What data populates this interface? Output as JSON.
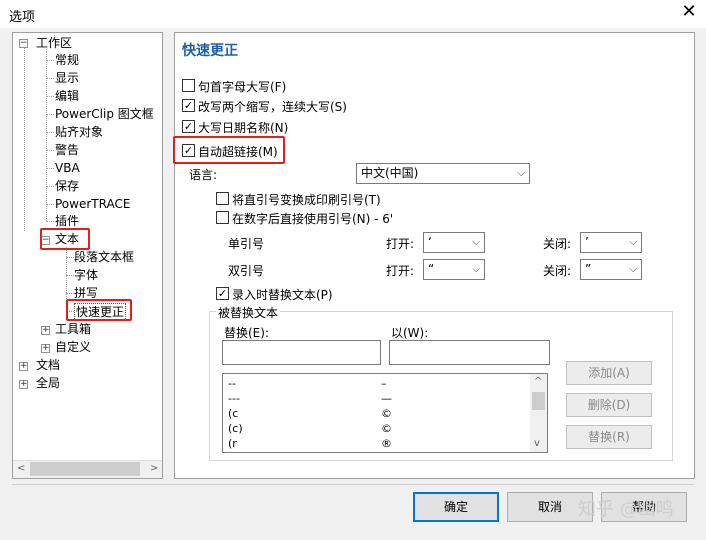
{
  "window": {
    "title": "选项",
    "close_label": "✕"
  },
  "tree": {
    "workspace": "工作区",
    "workspace_children": [
      "常规",
      "显示",
      "编辑",
      "PowerClip 图文框",
      "贴齐对象",
      "警告",
      "VBA",
      "保存",
      "PowerTRACE",
      "插件"
    ],
    "text": "文本",
    "text_children": [
      "段落文本框",
      "字体",
      "拼写",
      "快速更正"
    ],
    "toolbox": "工具箱",
    "customize": "自定义",
    "document": "文档",
    "global": "全局",
    "expanded_sign": "−",
    "collapsed_sign": "+",
    "scroll_left": "<",
    "scroll_right": ">"
  },
  "pane": {
    "heading": "快速更正",
    "opt_capitalize_first": "句首字母大写(F)",
    "opt_two_initial_caps": "改写两个缩写，连续大写(S)",
    "opt_capitalize_days": "大写日期名称(N)",
    "opt_hyperlink": "自动超链接(M)",
    "checks": {
      "capitalize_first": false,
      "two_initial_caps": true,
      "capitalize_days": true,
      "hyperlink": true,
      "straight_quotes": false,
      "primes": false,
      "replace_text": true
    },
    "check_mark": "✓",
    "language_label": "语言:",
    "language_value": "中文(中国)",
    "opt_straight_quotes": "将直引号变换成印刷引号(T)",
    "opt_primes": "在数字后直接使用引号(N) - 6'",
    "single_quote_label": "单引号",
    "double_quote_label": "双引号",
    "open_label": "打开:",
    "close_label": "关闭:",
    "single_open": "‘",
    "single_close": "’",
    "double_open": "“",
    "double_close": "”",
    "opt_replace_text": "录入时替换文本(P)",
    "replace_group": "被替换文本",
    "replace_label": "替换(E):",
    "with_label": "以(W):",
    "list_rows": [
      {
        "from": "--",
        "to": "–"
      },
      {
        "from": "---",
        "to": "—"
      },
      {
        "from": "(c",
        "to": "©"
      },
      {
        "from": "(c)",
        "to": "©"
      },
      {
        "from": "(r",
        "to": "®"
      }
    ],
    "add_button": "添加(A)",
    "delete_button": "删除(D)",
    "replace_button": "替换(R)",
    "scroll_up": "^",
    "scroll_down": "v",
    "chevron": "⌵"
  },
  "footer": {
    "ok": "确定",
    "cancel": "取消",
    "help": "帮助"
  },
  "watermark": "知乎 @幽鸣",
  "colors": {
    "heading": "#1c5fab",
    "highlight": "#e0201c",
    "default_button": "#0078d7"
  }
}
